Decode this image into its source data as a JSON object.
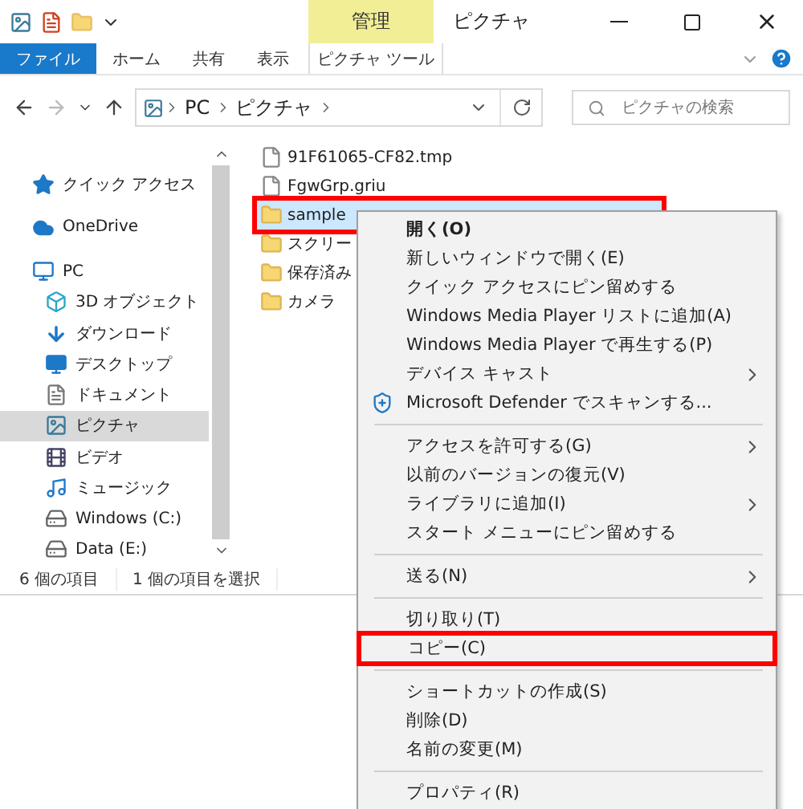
{
  "title_bar": {
    "context_group": "管理",
    "title": "ピクチャ"
  },
  "ribbon_tabs": [
    {
      "label": "ファイル",
      "kind": "file"
    },
    {
      "label": "ホーム",
      "kind": "tab"
    },
    {
      "label": "共有",
      "kind": "tab"
    },
    {
      "label": "表示",
      "kind": "tab"
    },
    {
      "label": "ピクチャ ツール",
      "kind": "context"
    }
  ],
  "address": {
    "parts": [
      "PC",
      "ピクチャ"
    ]
  },
  "search": {
    "placeholder": "ピクチャの検索"
  },
  "nav": [
    {
      "label": "クイック アクセス",
      "kind": "star",
      "selected": false
    },
    {
      "label": "OneDrive",
      "kind": "cloud",
      "selected": false
    },
    {
      "label": "PC",
      "kind": "pc",
      "selected": false,
      "children": [
        {
          "label": "3D オブジェクト",
          "kind": "cube",
          "selected": false
        },
        {
          "label": "ダウンロード",
          "kind": "download",
          "selected": false
        },
        {
          "label": "デスクトップ",
          "kind": "desktop",
          "selected": false
        },
        {
          "label": "ドキュメント",
          "kind": "document",
          "selected": false
        },
        {
          "label": "ピクチャ",
          "kind": "picture",
          "selected": true
        },
        {
          "label": "ビデオ",
          "kind": "video",
          "selected": false
        },
        {
          "label": "ミュージック",
          "kind": "music",
          "selected": false
        },
        {
          "label": "Windows (C:)",
          "kind": "drive",
          "selected": false
        },
        {
          "label": "Data (E:)",
          "kind": "drive",
          "selected": false
        }
      ]
    }
  ],
  "files": [
    {
      "name": "91F61065-CF82.tmp",
      "kind": "file",
      "selected": false,
      "highlighted": false
    },
    {
      "name": "FgwGrp.griu",
      "kind": "file",
      "selected": false,
      "highlighted": false
    },
    {
      "name": "sample",
      "kind": "folder",
      "selected": true,
      "highlighted": true
    },
    {
      "name": "スクリー",
      "kind": "folder",
      "selected": false,
      "highlighted": false
    },
    {
      "name": "保存済み",
      "kind": "folder",
      "selected": false,
      "highlighted": false
    },
    {
      "name": "カメラ",
      "kind": "folder",
      "selected": false,
      "highlighted": false
    }
  ],
  "status_bar": [
    "6 個の項目",
    "1 個の項目を選択"
  ],
  "context_menu": [
    {
      "kind": "item",
      "label": "開く(O)",
      "bold": true,
      "submenu": false,
      "highlighted": false
    },
    {
      "kind": "item",
      "label": "新しいウィンドウで開く(E)",
      "bold": false,
      "submenu": false,
      "highlighted": false
    },
    {
      "kind": "item",
      "label": "クイック アクセスにピン留めする",
      "bold": false,
      "submenu": false,
      "highlighted": false
    },
    {
      "kind": "item",
      "label": "Windows Media Player リストに追加(A)",
      "bold": false,
      "submenu": false,
      "highlighted": false
    },
    {
      "kind": "item",
      "label": "Windows Media Player で再生する(P)",
      "bold": false,
      "submenu": false,
      "highlighted": false
    },
    {
      "kind": "item",
      "label": "デバイス キャスト",
      "bold": false,
      "submenu": true,
      "highlighted": false
    },
    {
      "kind": "shield",
      "label": "Microsoft Defender でスキャンする...",
      "bold": false,
      "submenu": false,
      "highlighted": false
    },
    {
      "kind": "separator"
    },
    {
      "kind": "item",
      "label": "アクセスを許可する(G)",
      "bold": false,
      "submenu": true,
      "highlighted": false
    },
    {
      "kind": "item",
      "label": "以前のバージョンの復元(V)",
      "bold": false,
      "submenu": false,
      "highlighted": false
    },
    {
      "kind": "item",
      "label": "ライブラリに追加(I)",
      "bold": false,
      "submenu": true,
      "highlighted": false
    },
    {
      "kind": "item",
      "label": "スタート メニューにピン留めする",
      "bold": false,
      "submenu": false,
      "highlighted": false
    },
    {
      "kind": "separator"
    },
    {
      "kind": "item",
      "label": "送る(N)",
      "bold": false,
      "submenu": true,
      "highlighted": false
    },
    {
      "kind": "separator"
    },
    {
      "kind": "item",
      "label": "切り取り(T)",
      "bold": false,
      "submenu": false,
      "highlighted": false
    },
    {
      "kind": "item",
      "label": "コピー(C)",
      "bold": false,
      "submenu": false,
      "highlighted": true
    },
    {
      "kind": "separator"
    },
    {
      "kind": "item",
      "label": "ショートカットの作成(S)",
      "bold": false,
      "submenu": false,
      "highlighted": false
    },
    {
      "kind": "item",
      "label": "削除(D)",
      "bold": false,
      "submenu": false,
      "highlighted": false
    },
    {
      "kind": "item",
      "label": "名前の変更(M)",
      "bold": false,
      "submenu": false,
      "highlighted": false
    },
    {
      "kind": "separator"
    },
    {
      "kind": "item",
      "label": "プロパティ(R)",
      "bold": false,
      "submenu": false,
      "highlighted": false
    }
  ]
}
